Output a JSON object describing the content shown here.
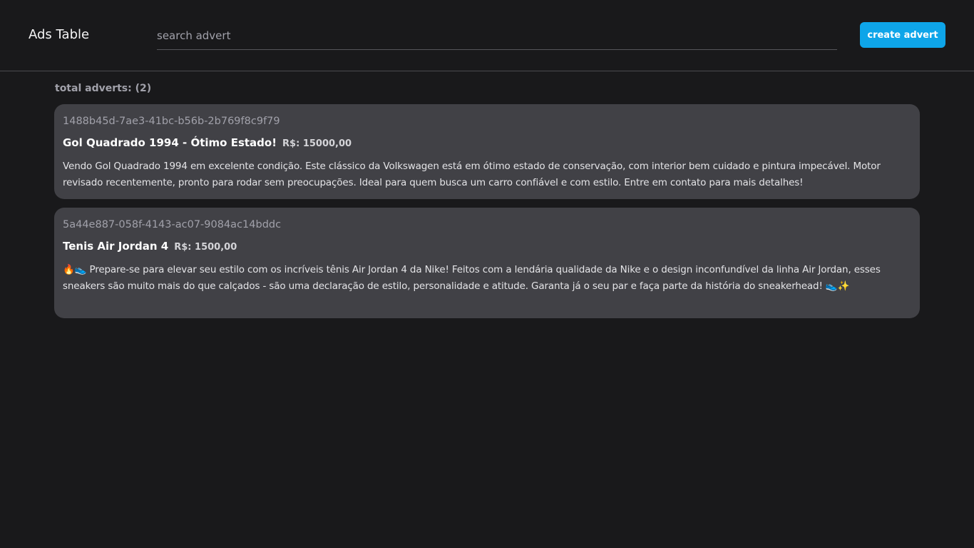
{
  "header": {
    "title": "Ads Table",
    "search_placeholder": "search advert",
    "search_value": "",
    "create_label": "create advert"
  },
  "summary": {
    "total_label": "total adverts: (2)"
  },
  "adverts": [
    {
      "id": "1488b45d-7ae3-41bc-b56b-2b769f8c9f79",
      "title": "Gol Quadrado 1994 - Ótimo Estado!",
      "price": "R$: 15000,00",
      "description": "Vendo Gol Quadrado 1994 em excelente condição. Este clássico da Volkswagen está em ótimo estado de conservação, com interior bem cuidado e pintura impecável. Motor revisado recentemente, pronto para rodar sem preocupações. Ideal para quem busca um carro confiável e com estilo. Entre em contato para mais detalhes!"
    },
    {
      "id": "5a44e887-058f-4143-ac07-9084ac14bddc",
      "title": "Tenis Air Jordan 4",
      "price": "R$: 1500,00",
      "description": "🔥👟 Prepare-se para elevar seu estilo com os incríveis tênis Air Jordan 4 da Nike! Feitos com a lendária qualidade da Nike e o design inconfundível da linha Air Jordan, esses sneakers são muito mais do que calçados - são uma declaração de estilo, personalidade e atitude. Garanta já o seu par e faça parte da história do sneakerhead! 👟✨"
    }
  ]
}
